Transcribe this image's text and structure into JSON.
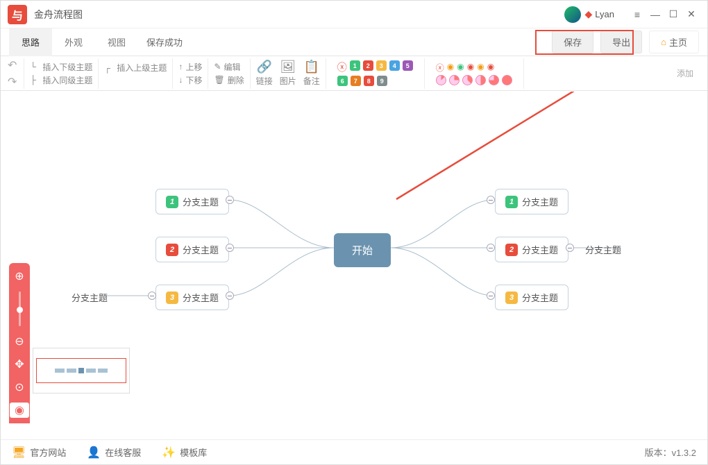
{
  "app": {
    "title": "金舟流程图",
    "logo_text": "与"
  },
  "user": {
    "name": "Lyan"
  },
  "tabs": {
    "t0": "思路",
    "t1": "外观",
    "t2": "视图",
    "save_status": "保存成功"
  },
  "buttons": {
    "save": "保存",
    "export": "导出",
    "home": "主页"
  },
  "toolbar": {
    "insert_child": "插入下级主题",
    "insert_parent": "插入上级主题",
    "insert_sibling": "插入同级主题",
    "move_up": "上移",
    "move_down": "下移",
    "edit": "编辑",
    "delete": "删除",
    "link": "链接",
    "image": "图片",
    "note": "备注",
    "addon": "添加"
  },
  "markers": {
    "top": [
      "1",
      "2",
      "3",
      "4",
      "5"
    ],
    "top_colors": [
      "#3cc47c",
      "#e74c3c",
      "#f5b942",
      "#4aa3e2",
      "#9b59b6"
    ],
    "bottom": [
      "6",
      "7",
      "8",
      "9"
    ],
    "bottom_colors": [
      "#3cc47c",
      "#e67e22",
      "#e74c3c",
      "#7f8c8d"
    ]
  },
  "mindmap": {
    "center": "开始",
    "branch_label": "分支主题",
    "left": [
      {
        "num": "1",
        "color": "b-green"
      },
      {
        "num": "2",
        "color": "b-red"
      },
      {
        "num": "3",
        "color": "b-yellow"
      }
    ],
    "right": [
      {
        "num": "1",
        "color": "b-green"
      },
      {
        "num": "2",
        "color": "b-red"
      },
      {
        "num": "3",
        "color": "b-yellow"
      }
    ]
  },
  "statusbar": {
    "site": "官方网站",
    "support": "在线客服",
    "templates": "模板库",
    "version_label": "版本：",
    "version": "v1.3.2"
  }
}
